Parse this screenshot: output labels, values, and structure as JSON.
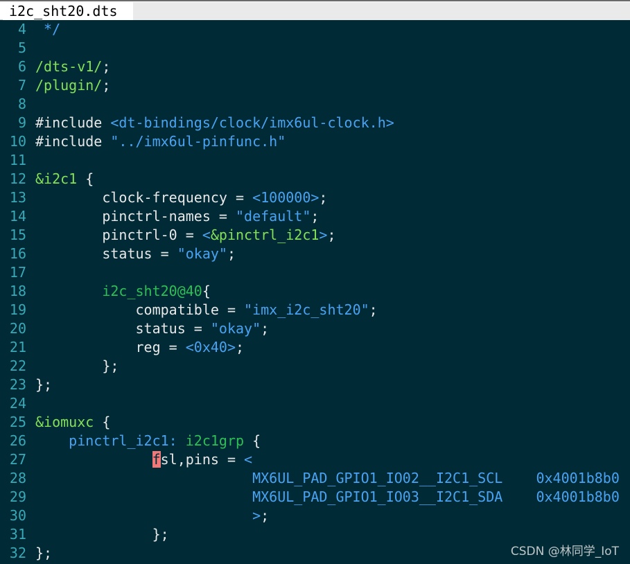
{
  "colors": {
    "background": "#002b36",
    "line_number": "#3aa8b7",
    "plain": "#e8e8e8",
    "keyword_green": "#85e05a",
    "string_blue": "#4aa3f2",
    "label_green": "#2fbf56",
    "cursor": "#f07878"
  },
  "tab": {
    "title": "i2c_sht20.dts"
  },
  "lines": [
    {
      "n": "4",
      "segs": [
        {
          "t": " */",
          "c": "#4aa3f2"
        }
      ]
    },
    {
      "n": "5",
      "segs": []
    },
    {
      "n": "6",
      "segs": [
        {
          "t": "/dts-v1/",
          "c": "#85e05a"
        },
        {
          "t": ";",
          "c": "#e8e8e8"
        }
      ]
    },
    {
      "n": "7",
      "segs": [
        {
          "t": "/plugin/",
          "c": "#85e05a"
        },
        {
          "t": ";",
          "c": "#e8e8e8"
        }
      ]
    },
    {
      "n": "8",
      "segs": []
    },
    {
      "n": "9",
      "segs": [
        {
          "t": "#include ",
          "c": "#e8e8e8"
        },
        {
          "t": "<dt-bindings/clock/imx6ul-clock.h>",
          "c": "#4aa3f2"
        }
      ]
    },
    {
      "n": "10",
      "segs": [
        {
          "t": "#include ",
          "c": "#e8e8e8"
        },
        {
          "t": "\"../imx6ul-pinfunc.h\"",
          "c": "#4aa3f2"
        }
      ]
    },
    {
      "n": "11",
      "segs": []
    },
    {
      "n": "12",
      "segs": [
        {
          "t": "&i2c1",
          "c": "#85e05a"
        },
        {
          "t": " {",
          "c": "#e8e8e8"
        }
      ]
    },
    {
      "n": "13",
      "segs": [
        {
          "t": "        clock-frequency = ",
          "c": "#e8e8e8"
        },
        {
          "t": "<100000>",
          "c": "#4aa3f2"
        },
        {
          "t": ";",
          "c": "#e8e8e8"
        }
      ]
    },
    {
      "n": "14",
      "segs": [
        {
          "t": "        pinctrl-names = ",
          "c": "#e8e8e8"
        },
        {
          "t": "\"default\"",
          "c": "#4aa3f2"
        },
        {
          "t": ";",
          "c": "#e8e8e8"
        }
      ]
    },
    {
      "n": "15",
      "segs": [
        {
          "t": "        pinctrl-0 = ",
          "c": "#e8e8e8"
        },
        {
          "t": "<",
          "c": "#4aa3f2"
        },
        {
          "t": "&pinctrl_i2c1",
          "c": "#85e05a"
        },
        {
          "t": ">",
          "c": "#4aa3f2"
        },
        {
          "t": ";",
          "c": "#e8e8e8"
        }
      ]
    },
    {
      "n": "16",
      "segs": [
        {
          "t": "        status = ",
          "c": "#e8e8e8"
        },
        {
          "t": "\"okay\"",
          "c": "#4aa3f2"
        },
        {
          "t": ";",
          "c": "#e8e8e8"
        }
      ]
    },
    {
      "n": "17",
      "segs": []
    },
    {
      "n": "18",
      "segs": [
        {
          "t": "        ",
          "c": "#e8e8e8"
        },
        {
          "t": "i2c_sht20@40",
          "c": "#2fbf56"
        },
        {
          "t": "{",
          "c": "#e8e8e8"
        }
      ]
    },
    {
      "n": "19",
      "segs": [
        {
          "t": "            compatible = ",
          "c": "#e8e8e8"
        },
        {
          "t": "\"imx_i2c_sht20\"",
          "c": "#4aa3f2"
        },
        {
          "t": ";",
          "c": "#e8e8e8"
        }
      ]
    },
    {
      "n": "20",
      "segs": [
        {
          "t": "            status = ",
          "c": "#e8e8e8"
        },
        {
          "t": "\"okay\"",
          "c": "#4aa3f2"
        },
        {
          "t": ";",
          "c": "#e8e8e8"
        }
      ]
    },
    {
      "n": "21",
      "segs": [
        {
          "t": "            reg = ",
          "c": "#e8e8e8"
        },
        {
          "t": "<0x40>",
          "c": "#4aa3f2"
        },
        {
          "t": ";",
          "c": "#e8e8e8"
        }
      ]
    },
    {
      "n": "22",
      "segs": [
        {
          "t": "        };",
          "c": "#e8e8e8"
        }
      ]
    },
    {
      "n": "23",
      "segs": [
        {
          "t": "};",
          "c": "#e8e8e8"
        }
      ]
    },
    {
      "n": "24",
      "segs": []
    },
    {
      "n": "25",
      "segs": [
        {
          "t": "&iomuxc",
          "c": "#85e05a"
        },
        {
          "t": " {",
          "c": "#e8e8e8"
        }
      ]
    },
    {
      "n": "26",
      "segs": [
        {
          "t": "    ",
          "c": "#e8e8e8"
        },
        {
          "t": "pinctrl_i2c1: ",
          "c": "#4aa3f2"
        },
        {
          "t": "i2c1grp",
          "c": "#2fbf56"
        },
        {
          "t": " {",
          "c": "#e8e8e8"
        }
      ]
    },
    {
      "n": "27",
      "segs": [
        {
          "t": "              ",
          "c": "#e8e8e8"
        },
        {
          "t": "f",
          "c": "#002b36",
          "bg": "#f07878"
        },
        {
          "t": "sl,pins = ",
          "c": "#e8e8e8"
        },
        {
          "t": "<",
          "c": "#4aa3f2"
        }
      ]
    },
    {
      "n": "28",
      "segs": [
        {
          "t": "                          MX6UL_PAD_GPIO1_IO02__I2C1_SCL    0x4001b8b0",
          "c": "#4aa3f2"
        }
      ]
    },
    {
      "n": "29",
      "segs": [
        {
          "t": "                          MX6UL_PAD_GPIO1_IO03__I2C1_SDA    0x4001b8b0",
          "c": "#4aa3f2"
        }
      ]
    },
    {
      "n": "30",
      "segs": [
        {
          "t": "                          >",
          "c": "#4aa3f2"
        },
        {
          "t": ";",
          "c": "#e8e8e8"
        }
      ]
    },
    {
      "n": "31",
      "segs": [
        {
          "t": "              };",
          "c": "#e8e8e8"
        }
      ]
    },
    {
      "n": "32",
      "segs": [
        {
          "t": "};",
          "c": "#e8e8e8"
        }
      ]
    }
  ],
  "watermark": "CSDN @林同学_IoT"
}
